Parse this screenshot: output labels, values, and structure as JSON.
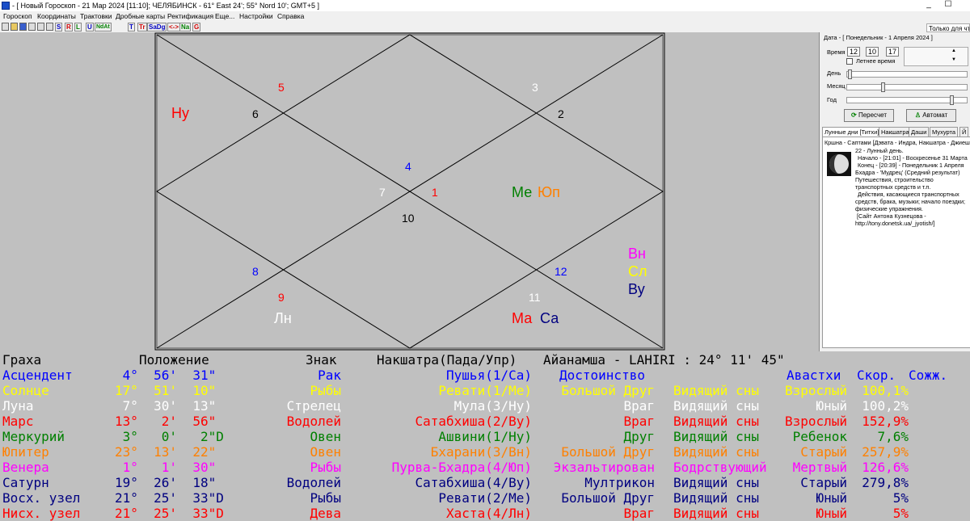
{
  "window": {
    "title": "- [ Новый Гороскоп - 21 Мар 2024 [11:10]; ЧЕЛЯБИНСК - 61° East 24'; 55° Nord 10'; GMT+5 ]",
    "minimize": "_",
    "maximize": "☐"
  },
  "menu": [
    "Гороскоп",
    "Координаты",
    "Трактовки",
    "Дробные карты",
    "Ректификация",
    "Еще...",
    "Настройки",
    "Справка"
  ],
  "toolbar": {
    "buttons": [
      "S",
      "R",
      "L",
      "U",
      "NdAt",
      "T",
      "Tr",
      "SaDg",
      "<->",
      "Na",
      "G"
    ],
    "readonly_label": "Только для чтения"
  },
  "chart": {
    "houses": [
      {
        "label": "1",
        "color": "#ff0000"
      },
      {
        "label": "2",
        "color": "#000000"
      },
      {
        "label": "3",
        "color": "#ffffff"
      },
      {
        "label": "4",
        "color": "#0000ff"
      },
      {
        "label": "5",
        "color": "#ff0000"
      },
      {
        "label": "6",
        "color": "#000000"
      },
      {
        "label": "7",
        "color": "#ffffff"
      },
      {
        "label": "8",
        "color": "#0000ff"
      },
      {
        "label": "9",
        "color": "#ff0000"
      },
      {
        "label": "10",
        "color": "#000000"
      },
      {
        "label": "11",
        "color": "#ffffff"
      },
      {
        "label": "12",
        "color": "#0000ff"
      }
    ],
    "planets": [
      {
        "label": "Ну",
        "color": "#ff0000"
      },
      {
        "label": "Ме",
        "color": "#008000"
      },
      {
        "label": "Юп",
        "color": "#ff8000"
      },
      {
        "label": "Вн",
        "color": "#ff00ff"
      },
      {
        "label": "Сл",
        "color": "#ffff00"
      },
      {
        "label": "Ву",
        "color": "#000080"
      },
      {
        "label": "Ма",
        "color": "#ff0000"
      },
      {
        "label": "Са",
        "color": "#000080"
      },
      {
        "label": "Лн",
        "color": "#ffffff"
      }
    ]
  },
  "right_panel": {
    "date_label": "Дата - [ Понедельник -  1 Апреля   2024 ]",
    "time_label": "Время",
    "hours": "12",
    "minutes": "10",
    "seconds": "17",
    "summer_time_label": "Летнее время",
    "day_label": "День",
    "month_label": "Месяц",
    "year_label": "Год",
    "day_level": 0.01,
    "month_level": 0.3,
    "year_level": 0.9,
    "recalc_label": "Пересчет",
    "auto_label": "Автомат",
    "tabs": [
      "Лунные дни [Титхи]",
      "Накшатра",
      "Даши",
      "Мухурта",
      "Й"
    ],
    "info_lines": [
      "Кршна - Саптами [Дэвата - Индра, Накшатра - Джиешта]",
      "22 - Лунный день.",
      "Начало - [21:01] -  Воскресенье 31 Марта",
      "Конец - [20:39] -  Понедельник  1 Апреля",
      "Бхадра - 'Мудрец' (Средний результат)",
      "Путешествия, строительство",
      "транспортных средств и т.п.",
      "Действия, касающиеся транспортных",
      "средств, брака, музыки; начало поездки;",
      "физические упражнения.",
      "[Сайт Антона Кузнецова -",
      "http://tony.donetsk.ua/_jyotish/]"
    ]
  },
  "table": {
    "header": [
      "Граха",
      "Положение",
      "Знак",
      "Накшатра(Пада/Упр)",
      "Айанамша - LAHIRI : 24° 11' 45\""
    ],
    "header2": [
      "Достоинство",
      "Авастхи",
      "Скор.",
      "Сожж."
    ],
    "rows": [
      {
        "name": "Асцендент",
        "pos": " 4°  56'  31\"",
        "sign": "Рак",
        "nak": "Пушья(1/Са)",
        "dignity": "",
        "state": "",
        "avastha": "",
        "speed": "",
        "color": "#0000ff"
      },
      {
        "name": "Солнце",
        "pos": "17°  51'  10\"",
        "sign": "Рыбы",
        "nak": "Ревати(1/Ме)",
        "dignity": "Большой Друг",
        "state": "Видящий сны",
        "avastha": "Взрослый",
        "speed": "100,1%",
        "color": "#ffff00"
      },
      {
        "name": "Луна",
        "pos": " 7°  30'  13\"",
        "sign": "Стрелец",
        "nak": "Мула(3/Ну)",
        "dignity": "Враг",
        "state": "Видящий сны",
        "avastha": "Юный",
        "speed": "100,2%",
        "color": "#ffffff"
      },
      {
        "name": "Марс",
        "pos": "13°   2'  56\"",
        "sign": "Водолей",
        "nak": "Сатабхиша(2/Ву)",
        "dignity": "Враг",
        "state": "Видящий сны",
        "avastha": "Взрослый",
        "speed": "152,9%",
        "color": "#ff0000"
      },
      {
        "name": "Меркурий",
        "pos": " 3°   0'   2\"D",
        "sign": "Овен",
        "nak": "Ашвини(1/Ну)",
        "dignity": "Друг",
        "state": "Видящий сны",
        "avastha": "Ребенок",
        "speed": "7,6%",
        "color": "#008000"
      },
      {
        "name": "Юпитер",
        "pos": "23°  13'  22\"",
        "sign": "Овен",
        "nak": "Бхарани(3/Вн)",
        "dignity": "Большой Друг",
        "state": "Видящий сны",
        "avastha": "Старый",
        "speed": "257,9%",
        "color": "#ff8000"
      },
      {
        "name": "Венера",
        "pos": " 1°   1'  30\"",
        "sign": "Рыбы",
        "nak": "Пурва-Бхадра(4/Юп)",
        "dignity": "Экзальтирован",
        "state": "Бодрствующий",
        "avastha": "Мертвый",
        "speed": "126,6%",
        "color": "#ff00ff"
      },
      {
        "name": "Сатурн",
        "pos": "19°  26'  18\"",
        "sign": "Водолей",
        "nak": "Сатабхиша(4/Ву)",
        "dignity": "Мултрикон",
        "state": "Видящий сны",
        "avastha": "Старый",
        "speed": "279,8%",
        "color": "#000080"
      },
      {
        "name": "Восх. узел",
        "pos": "21°  25'  33\"D",
        "sign": "Рыбы",
        "nak": "Ревати(2/Ме)",
        "dignity": "Большой Друг",
        "state": "Видящий сны",
        "avastha": "Юный",
        "speed": "5%",
        "color": "#000080"
      },
      {
        "name": "Нисх. узел",
        "pos": "21°  25'  33\"D",
        "sign": "Дева",
        "nak": "Хаста(4/Лн)",
        "dignity": "Враг",
        "state": "Видящий сны",
        "avastha": "Юный",
        "speed": "5%",
        "color": "#ff0000"
      }
    ]
  }
}
